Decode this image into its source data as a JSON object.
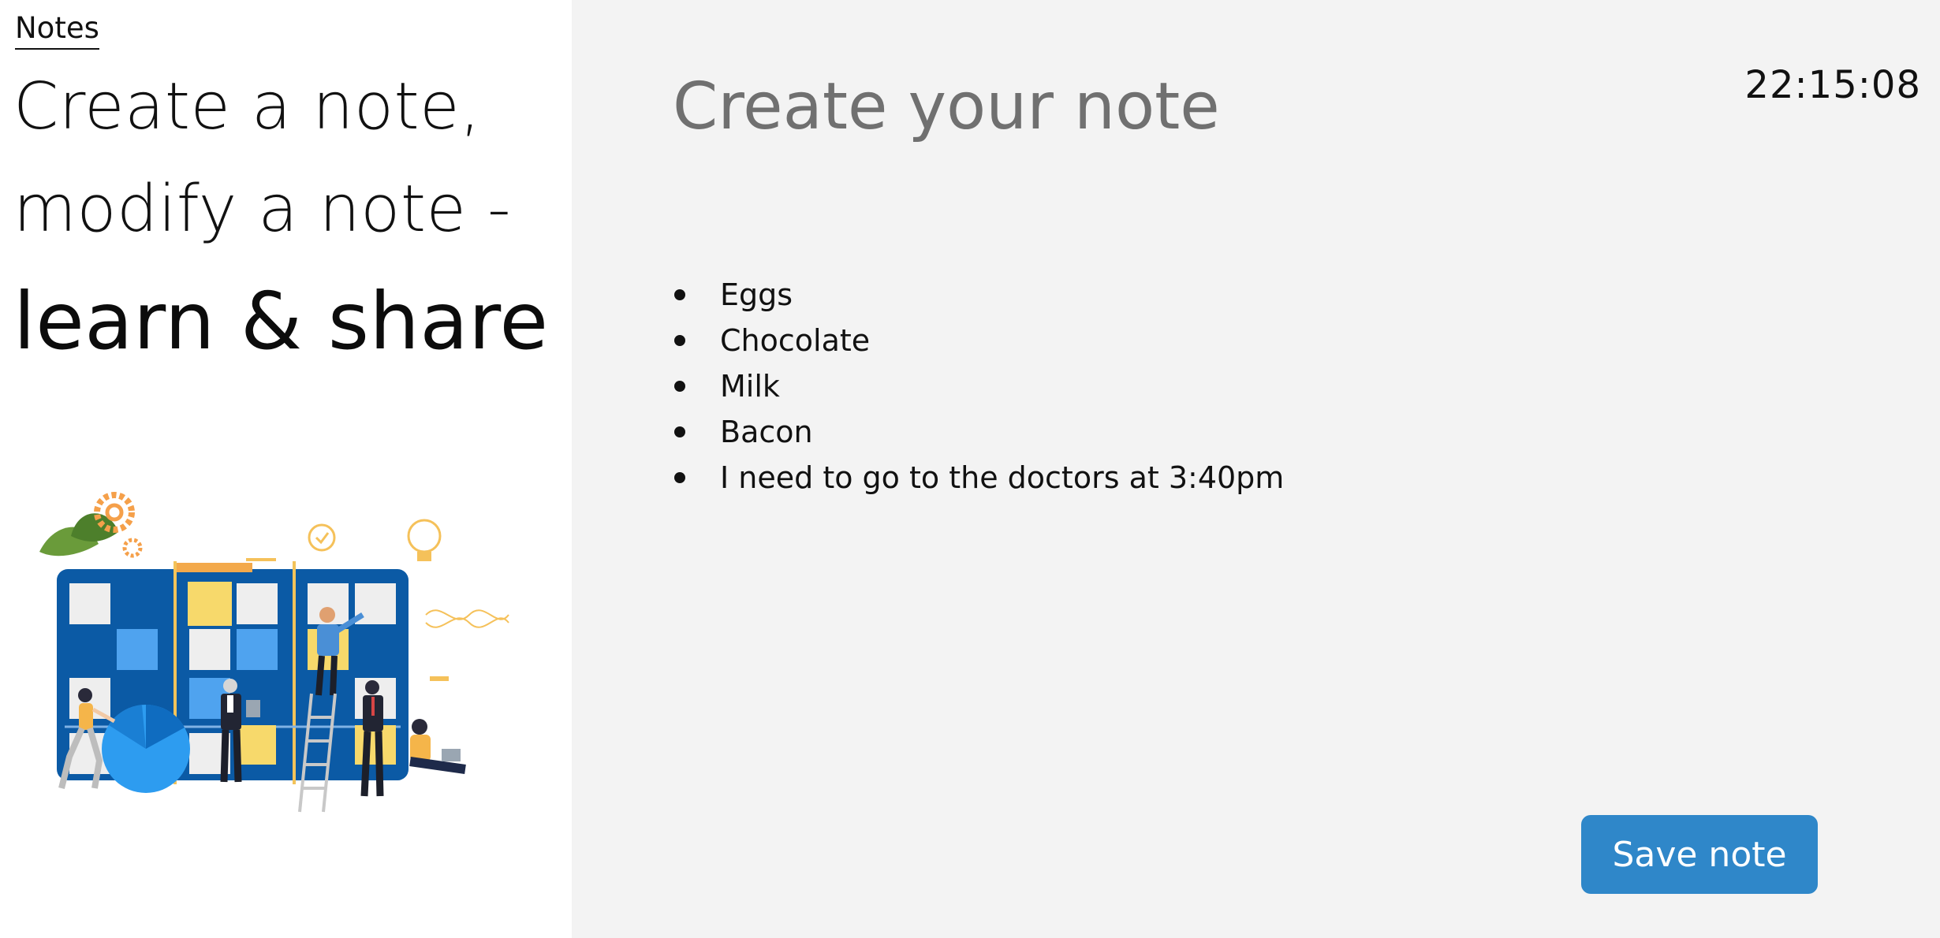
{
  "nav": {
    "notes_label": "Notes"
  },
  "hero": {
    "line1": "Create a note,",
    "line2": "modify a note -",
    "line3": "learn & share"
  },
  "editor": {
    "title": "Create your note",
    "clock": "22:15:08",
    "items": [
      "Eggs",
      "Chocolate",
      "Milk",
      "Bacon",
      "I need to go to the doctors at 3:40pm"
    ],
    "save_label": "Save note"
  },
  "colors": {
    "accent": "#2f87c9",
    "panel_bg": "#f3f3f3",
    "title_gray": "#707070",
    "board_blue": "#0b5aa5"
  }
}
